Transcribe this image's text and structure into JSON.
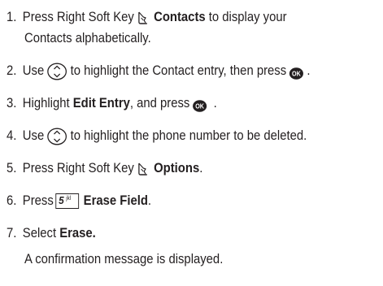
{
  "steps": [
    {
      "n": "1.",
      "a": "Press Right Soft Key",
      "b": "Contacts",
      "c": "to display your"
    },
    {
      "cont": "Contacts alphabetically."
    },
    {
      "n": "2.",
      "a": "Use",
      "b": "to highlight the Contact entry, then press",
      "c": "."
    },
    {
      "n": "3.",
      "a": "Highlight",
      "b": "Edit Entry",
      "c": ", and press",
      "d": "."
    },
    {
      "n": "4.",
      "a": "Use",
      "b": "to highlight the phone number to be deleted."
    },
    {
      "n": "5.",
      "a": "Press Right Soft Key",
      "b": "Options",
      "c": "."
    },
    {
      "n": "6.",
      "a": "Press",
      "key": "5",
      "keysub": "jkl",
      "b": "Erase Field",
      "c": "."
    },
    {
      "n": "7.",
      "a": "Select",
      "b": "Erase."
    },
    {
      "cont": "A confirmation message is displayed."
    }
  ],
  "icons": {
    "soft_key": "right-soft-key-icon",
    "nav": "navigation-key-icon",
    "ok": "ok-key-icon",
    "ok_label": "OK"
  },
  "colors": {
    "text": "#231f20",
    "background": "#ffffff"
  }
}
